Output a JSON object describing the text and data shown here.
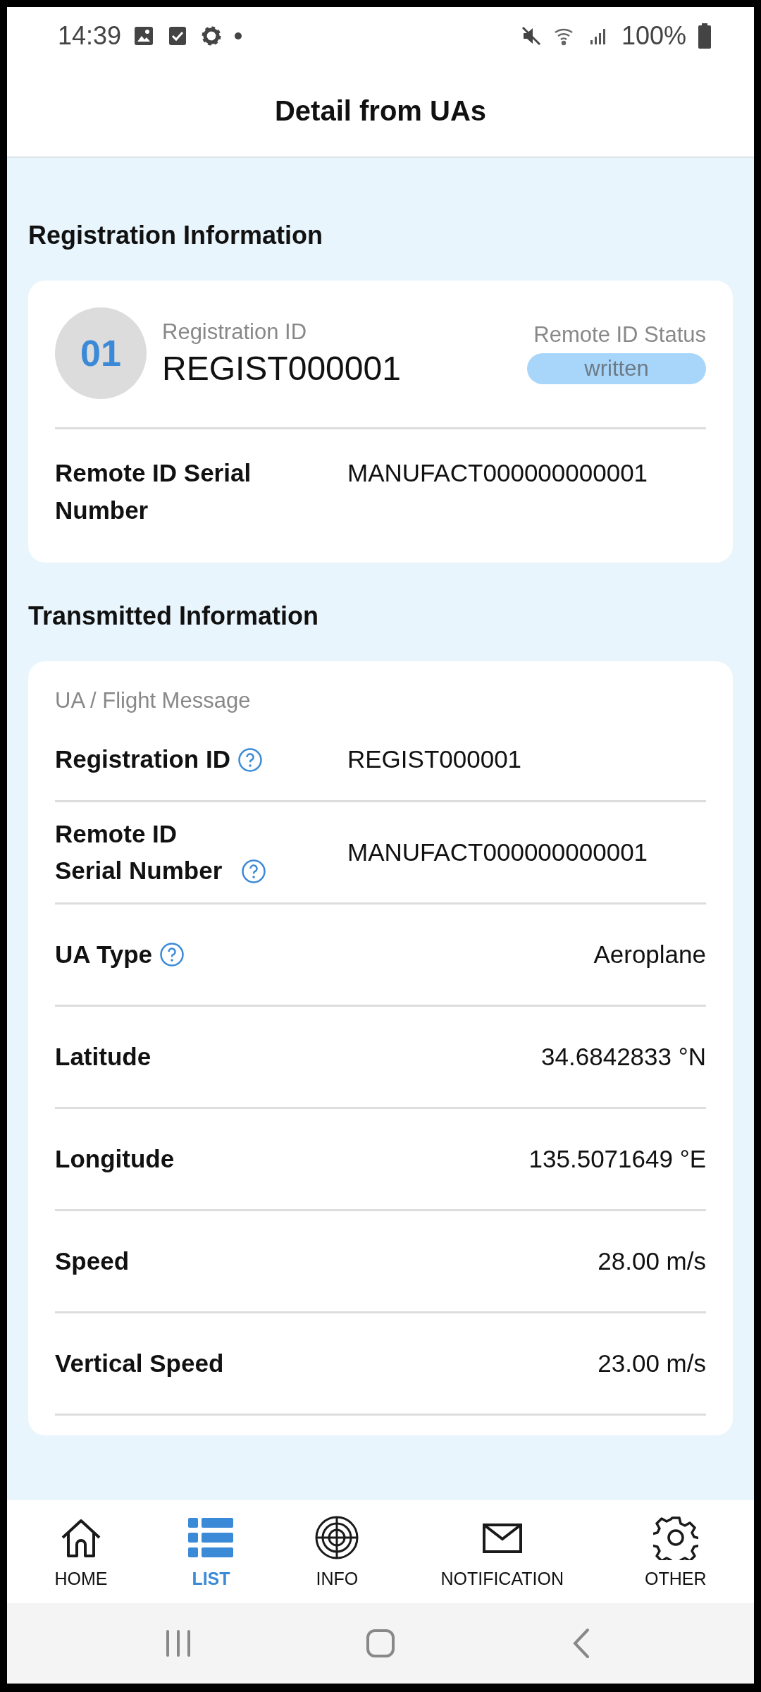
{
  "status_bar": {
    "time": "14:39",
    "battery": "100%"
  },
  "header": {
    "title": "Detail from UAs"
  },
  "registration": {
    "heading": "Registration Information",
    "number": "01",
    "id_label": "Registration ID",
    "id_value": "REGIST000001",
    "status_label": "Remote ID Status",
    "status": "written",
    "serial_label": "Remote ID Serial Number",
    "serial_value": "MANUFACT000000000001"
  },
  "transmitted": {
    "heading": "Transmitted Information",
    "group_label": "UA / Flight Message",
    "rows": [
      {
        "label": "Registration ID",
        "value": "REGIST000001",
        "help": true,
        "kind": "column"
      },
      {
        "label": "Remote ID Serial Number",
        "value": "MANUFACT000000000001",
        "help": true,
        "kind": "column"
      },
      {
        "label": "UA Type",
        "value": "Aeroplane",
        "help": true,
        "kind": "right"
      },
      {
        "label": "Latitude",
        "value": "34.6842833 °N",
        "help": false,
        "kind": "right"
      },
      {
        "label": "Longitude",
        "value": "135.5071649 °E",
        "help": false,
        "kind": "right"
      },
      {
        "label": "Speed",
        "value": "28.00 m/s",
        "help": false,
        "kind": "right"
      },
      {
        "label": "Vertical Speed",
        "value": "23.00 m/s",
        "help": false,
        "kind": "right"
      }
    ]
  },
  "bottom_nav": [
    {
      "label": "HOME",
      "selected": false
    },
    {
      "label": "LIST",
      "selected": true
    },
    {
      "label": "INFO",
      "selected": false
    },
    {
      "label": "NOTIFICATION",
      "selected": false
    },
    {
      "label": "OTHER",
      "selected": false
    }
  ]
}
